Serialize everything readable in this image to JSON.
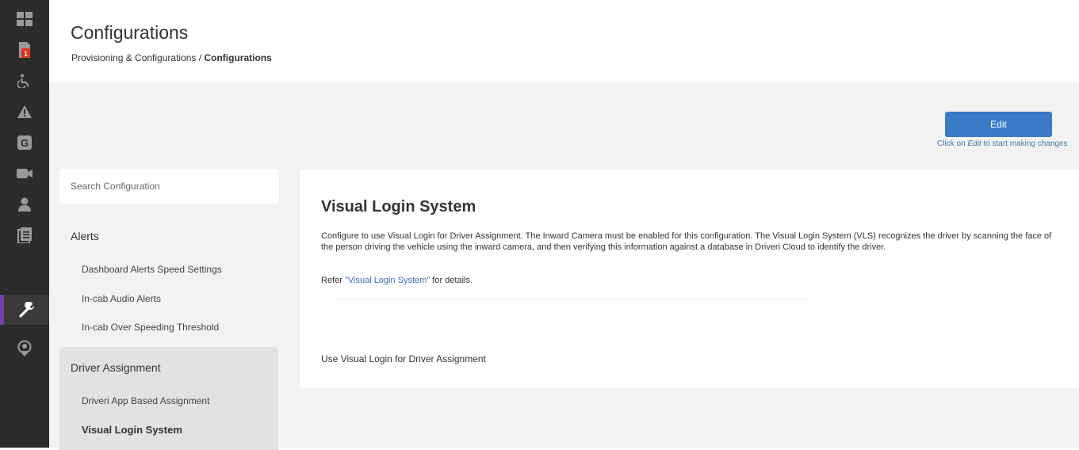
{
  "header": {
    "title": "Configurations",
    "breadcrumb_parent": "Provisioning & Configurations",
    "breadcrumb_separator": "/",
    "breadcrumb_current": "Configurations"
  },
  "rail": {
    "items": [
      {
        "icon": "grid-icon"
      },
      {
        "icon": "document-alert-icon",
        "badge": "1"
      },
      {
        "icon": "wheelchair-icon"
      },
      {
        "icon": "warning-icon"
      },
      {
        "icon": "g-icon",
        "text": "G"
      },
      {
        "icon": "camera-icon"
      },
      {
        "icon": "user-icon"
      },
      {
        "icon": "report-icon"
      },
      {
        "icon": "wrench-icon",
        "active": true
      },
      {
        "icon": "map-pin-icon"
      }
    ],
    "active_color": "#7b3fa8"
  },
  "toolbar": {
    "edit_label": "Edit",
    "hint_prefix": "Click on ",
    "hint_em": "Edit",
    "hint_suffix": " to start making changes"
  },
  "sidebar": {
    "search_placeholder": "Search Configuration",
    "groups": [
      {
        "title": "Alerts",
        "items": [
          "Dashboard Alerts Speed Settings",
          "In-cab Audio Alerts",
          "In-cab Over Speeding Threshold"
        ]
      },
      {
        "title": "Driver Assignment",
        "items": [
          "Driveri App Based Assignment",
          "Visual Login System"
        ]
      }
    ]
  },
  "content": {
    "title": "Visual Login System",
    "description": "Configure to use Visual Login for Driver Assignment. The Inward Camera must be enabled for this configuration. The Visual Login System (VLS) recognizes the driver by scanning the face of the person driving the vehicle using the inward camera, and then verifying this information against a database in Driveri Cloud to identify the driver.",
    "ref_prefix": "Refer ",
    "ref_link": "\"Visual Login System\"",
    "ref_suffix": " for details.",
    "setting_label": "Use Visual Login for Driver Assignment"
  },
  "colors": {
    "button": "#3a7bc8",
    "rail_bg": "#2c2c2c",
    "badge": "#e0301e"
  }
}
